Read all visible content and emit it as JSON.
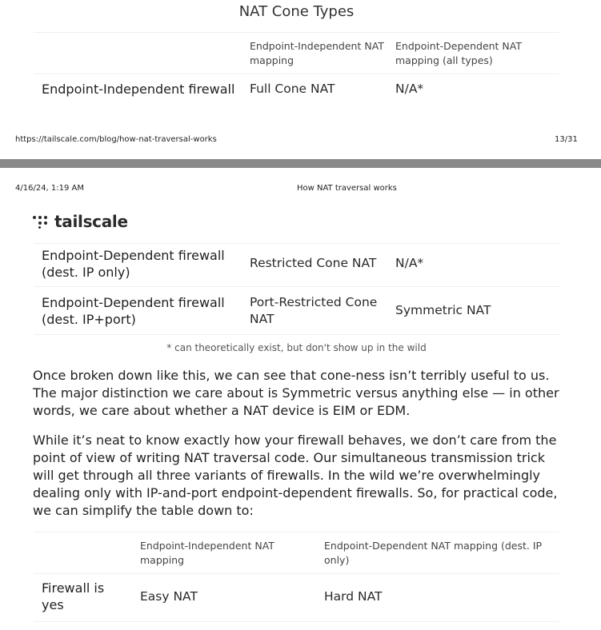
{
  "top_page": {
    "title": "NAT Cone Types",
    "table": {
      "headers": [
        "",
        "Endpoint-Independent NAT mapping",
        "Endpoint-Dependent NAT mapping (all types)"
      ],
      "rows": [
        [
          "Endpoint-Independent firewall",
          "Full Cone NAT",
          "N/A*"
        ]
      ]
    },
    "footer": {
      "url": "https://tailscale.com/blog/how-nat-traversal-works",
      "page": "13/31"
    }
  },
  "bottom_page": {
    "header": {
      "datetime": "4/16/24, 1:19 AM",
      "doc_title": "How NAT traversal works"
    },
    "logo": {
      "icon": "tailscale-dots-icon",
      "text": "tailscale"
    },
    "table": {
      "rows": [
        [
          "Endpoint-Dependent firewall (dest. IP only)",
          "Restricted Cone NAT",
          "N/A*"
        ],
        [
          "Endpoint-Dependent firewall (dest. IP+port)",
          "Port-Restricted Cone NAT",
          "Symmetric NAT"
        ]
      ],
      "footnote": "* can theoretically exist, but don't show up in the wild"
    },
    "paragraphs": [
      "Once broken down like this, we can see that cone-ness isn’t terribly useful to us. The major distinction we care about is Symmetric versus anything else — in other words, we care about whether a NAT device is EIM or EDM.",
      "While it’s neat to know exactly how your firewall behaves, we don’t care from the point of view of writing NAT traversal code. Our simultaneous transmission trick will get through all three variants of firewalls. In the wild we’re overwhelmingly dealing only with IP-and-port endpoint-dependent firewalls. So, for practical code, we can simplify the table down to:"
    ],
    "table2": {
      "headers": [
        "",
        "Endpoint-Independent NAT mapping",
        "Endpoint-Dependent NAT mapping (dest. IP only)"
      ],
      "rows": [
        [
          "Firewall is yes",
          "Easy NAT",
          "Hard NAT"
        ]
      ]
    }
  },
  "colors": {
    "separator": "#8a8a8a",
    "text": "#222222",
    "rule": "#efefef"
  }
}
